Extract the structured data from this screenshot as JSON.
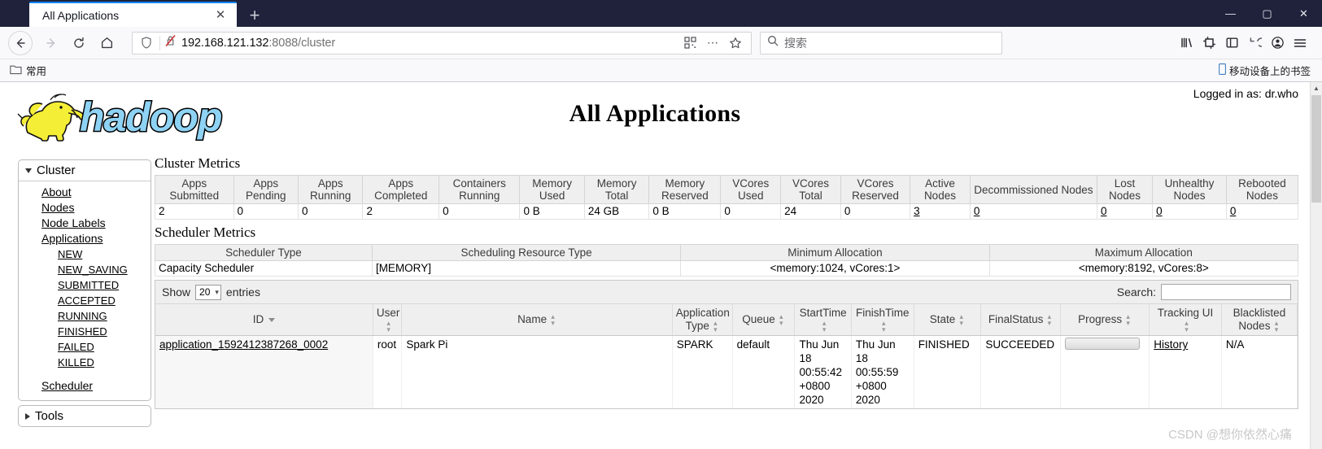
{
  "browser": {
    "tab_title": "All Applications",
    "close_tab_glyph": "✕",
    "new_tab_glyph": "+",
    "window_minimize": "—",
    "window_maximize": "▢",
    "window_close": "✕",
    "url_host": "192.168.121.132",
    "url_path": ":8088/cluster",
    "search_placeholder": "搜索",
    "bookmark_folder": "常用",
    "bookmark_mobile": "移动设备上的书签"
  },
  "page": {
    "logged_in": "Logged in as: dr.who",
    "title": "All Applications",
    "logo_alt": "hadoop",
    "watermark": "CSDN @想你依然心痛"
  },
  "sidebar": {
    "cluster_header": "Cluster",
    "tools_header": "Tools",
    "items": [
      {
        "label": "About"
      },
      {
        "label": "Nodes"
      },
      {
        "label": "Node Labels"
      },
      {
        "label": "Applications"
      }
    ],
    "app_states": [
      {
        "label": "NEW"
      },
      {
        "label": "NEW_SAVING"
      },
      {
        "label": "SUBMITTED"
      },
      {
        "label": "ACCEPTED"
      },
      {
        "label": "RUNNING"
      },
      {
        "label": "FINISHED"
      },
      {
        "label": "FAILED"
      },
      {
        "label": "KILLED"
      }
    ],
    "scheduler_label": "Scheduler"
  },
  "cluster_metrics": {
    "title": "Cluster Metrics",
    "headers": [
      "Apps Submitted",
      "Apps Pending",
      "Apps Running",
      "Apps Completed",
      "Containers Running",
      "Memory Used",
      "Memory Total",
      "Memory Reserved",
      "VCores Used",
      "VCores Total",
      "VCores Reserved",
      "Active Nodes",
      "Decommissioned Nodes",
      "Lost Nodes",
      "Unhealthy Nodes",
      "Rebooted Nodes"
    ],
    "values": [
      "2",
      "0",
      "0",
      "2",
      "0",
      "0 B",
      "24 GB",
      "0 B",
      "0",
      "24",
      "0",
      "3",
      "0",
      "0",
      "0",
      "0"
    ],
    "linked": [
      false,
      false,
      false,
      false,
      false,
      false,
      false,
      false,
      false,
      false,
      false,
      true,
      true,
      true,
      true,
      true
    ]
  },
  "scheduler_metrics": {
    "title": "Scheduler Metrics",
    "headers": [
      "Scheduler Type",
      "Scheduling Resource Type",
      "Minimum Allocation",
      "Maximum Allocation"
    ],
    "values": [
      "Capacity Scheduler",
      "[MEMORY]",
      "<memory:1024, vCores:1>",
      "<memory:8192, vCores:8>"
    ]
  },
  "datatable": {
    "show_label": "Show",
    "entries_length": "20",
    "entries_label": "entries",
    "search_label": "Search:",
    "search_value": "",
    "headers": [
      "ID",
      "User",
      "Name",
      "Application Type",
      "Queue",
      "StartTime",
      "FinishTime",
      "State",
      "FinalStatus",
      "Progress",
      "Tracking UI",
      "Blacklisted Nodes"
    ],
    "rows": [
      {
        "id": "application_1592412387268_0002",
        "user": "root",
        "name": "Spark Pi",
        "application_type": "SPARK",
        "queue": "default",
        "start_time": "Thu Jun 18 00:55:42 +0800 2020",
        "finish_time": "Thu Jun 18 00:55:59 +0800 2020",
        "state": "FINISHED",
        "final_status": "SUCCEEDED",
        "progress": "",
        "tracking_ui": "History",
        "blacklisted_nodes": "N/A"
      }
    ]
  }
}
